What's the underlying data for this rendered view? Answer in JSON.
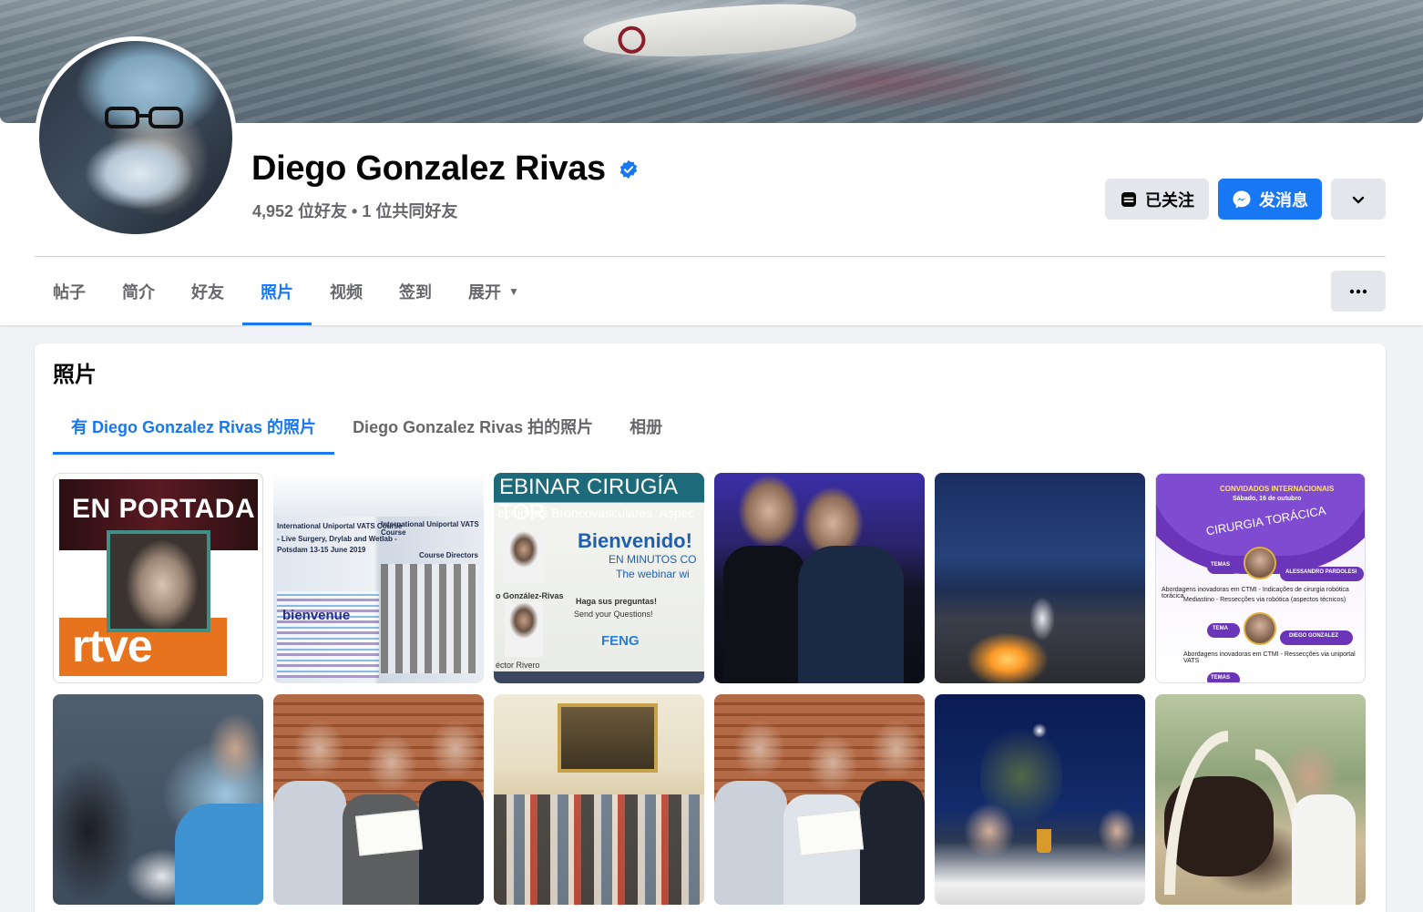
{
  "profile": {
    "name": "Diego Gonzalez Rivas",
    "verified_icon": "verified-badge-icon",
    "friends_line": "4,952 位好友 • 1 位共同好友",
    "actions": {
      "following_label": "已关注",
      "message_label": "发消息"
    }
  },
  "nav": {
    "tabs": [
      {
        "label": "帖子",
        "active": false
      },
      {
        "label": "简介",
        "active": false
      },
      {
        "label": "好友",
        "active": false
      },
      {
        "label": "照片",
        "active": true
      },
      {
        "label": "视频",
        "active": false
      },
      {
        "label": "签到",
        "active": false
      },
      {
        "label": "展开",
        "active": false
      }
    ],
    "more_icon": "ellipsis-icon"
  },
  "photos": {
    "title": "照片",
    "subtabs": [
      {
        "label": "有 Diego Gonzalez Rivas 的照片",
        "active": true
      },
      {
        "label": "Diego Gonzalez Rivas 拍的照片",
        "active": false
      },
      {
        "label": "相册",
        "active": false
      }
    ],
    "tiles": {
      "t1_line1": "EN PORTADA",
      "t1_line2": "rtve",
      "t2_header": "International Uniportal VATS Course",
      "t2_sub": "- Live Surgery, Drylab and Wetlab -",
      "t2_dates": "Potsdam 13-15 June 2019",
      "t2_directors": "Course Directors",
      "t2_word": "bienvenue",
      "t3_head": "EBINAR CIRUGÍA TOR",
      "t3_sub": "ecciones Broncovasculares, Aspec",
      "t3_welcome": "Bienvenido!",
      "t3_minutes": "EN MINUTOS CO",
      "t3_webinar": "The webinar wi",
      "t3_name1": "o González-Rivas",
      "t3_questions": "Haga sus preguntas!",
      "t3_questions2": "Send your Questions!",
      "t3_brand": "FENG",
      "t3_name2": "éctor Rivero",
      "t6_header": "CONVIDADOS INTERNACIONAIS",
      "t6_date": "Sábado, 16 de outubro",
      "t6_title": "CIRURGIA TORÁCICA",
      "t6_label1": "TEMAS",
      "t6_speaker1": "ALESSANDRO PARDOLESI",
      "t6_topic1": "Abordagens inovadoras em CTMI - Indicações de cirurgia robótica torácica",
      "t6_topic1b": "Mediastino - Ressecções via robótica (aspectos técnicos)",
      "t6_label2": "TEMA",
      "t6_speaker2": "DIEGO GONZALEZ",
      "t6_topic2": "Abordagens inovadoras em CTMI - Ressecções via uniportal VATS",
      "t6_label3": "TEMAS"
    }
  },
  "colors": {
    "accent": "#1877f2",
    "text_secondary": "#65676b",
    "button_gray": "#e4e6eb",
    "page_bg": "#f0f2f5"
  }
}
